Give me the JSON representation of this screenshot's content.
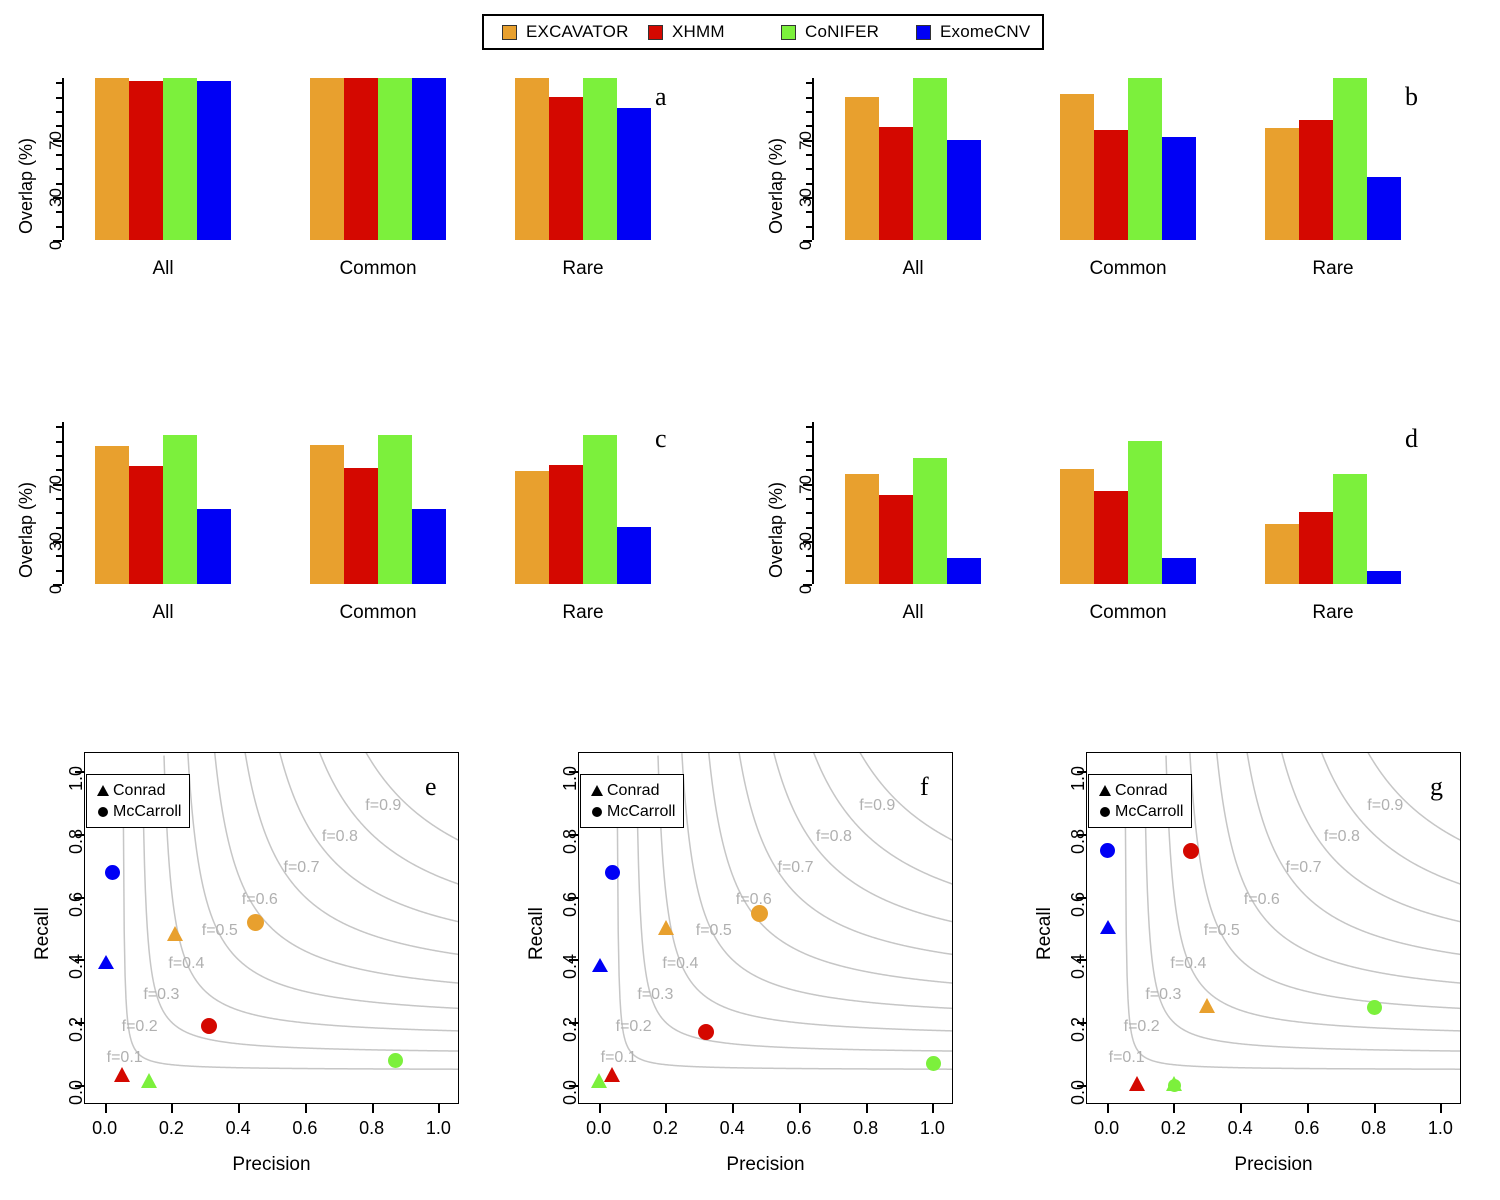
{
  "legend": {
    "items": [
      {
        "label": "EXCAVATOR",
        "color": "#e8a02e",
        "x": 18
      },
      {
        "label": "XHMM",
        "color": "#d40800",
        "x": 164
      },
      {
        "label": "CoNIFER",
        "color": "#7cf03c",
        "x": 297
      },
      {
        "label": "ExomeCNV",
        "color": "#0000f5",
        "x": 432
      }
    ]
  },
  "colors": {
    "excavator": "#e8a02e",
    "xhmm": "#d40800",
    "conifer": "#7cf03c",
    "exomecnv": "#0000f5",
    "contour": "#c6c6c6",
    "flabel": "#b0b0b0"
  },
  "bar_axis": {
    "ylabel": "Overlap (%)",
    "ticks": [
      0,
      30,
      70
    ],
    "tick_labels": [
      "0",
      "30",
      "70"
    ],
    "group_labels": [
      "All",
      "Common",
      "Rare"
    ],
    "series_order": [
      "EXCAVATOR",
      "XHMM",
      "CoNIFER",
      "ExomeCNV"
    ],
    "ymax": 113
  },
  "chart_data": [
    {
      "type": "bar",
      "panel": "a",
      "title": "a",
      "ylabel": "Overlap (%)",
      "xlabel": "",
      "ylim": [
        0,
        113
      ],
      "yticks": [
        0,
        30,
        70
      ],
      "categories": [
        "All",
        "Common",
        "Rare"
      ],
      "series": [
        {
          "name": "EXCAVATOR",
          "color": "#e8a02e",
          "values": [
            113,
            113,
            113
          ]
        },
        {
          "name": "XHMM",
          "color": "#d40800",
          "values": [
            111,
            113,
            100
          ]
        },
        {
          "name": "CoNIFER",
          "color": "#7cf03c",
          "values": [
            113,
            113,
            113
          ]
        },
        {
          "name": "ExomeCNV",
          "color": "#0000f5",
          "values": [
            111,
            113,
            92
          ]
        }
      ]
    },
    {
      "type": "bar",
      "panel": "b",
      "title": "b",
      "ylabel": "Overlap (%)",
      "xlabel": "",
      "ylim": [
        0,
        113
      ],
      "yticks": [
        0,
        30,
        70
      ],
      "categories": [
        "All",
        "Common",
        "Rare"
      ],
      "series": [
        {
          "name": "EXCAVATOR",
          "color": "#e8a02e",
          "values": [
            100,
            102,
            78
          ]
        },
        {
          "name": "XHMM",
          "color": "#d40800",
          "values": [
            79,
            77,
            84
          ]
        },
        {
          "name": "CoNIFER",
          "color": "#7cf03c",
          "values": [
            113,
            113,
            113
          ]
        },
        {
          "name": "ExomeCNV",
          "color": "#0000f5",
          "values": [
            70,
            72,
            44
          ]
        }
      ]
    },
    {
      "type": "bar",
      "panel": "c",
      "title": "c",
      "ylabel": "Overlap (%)",
      "xlabel": "",
      "ylim": [
        0,
        113
      ],
      "yticks": [
        0,
        30,
        70
      ],
      "categories": [
        "All",
        "Common",
        "Rare"
      ],
      "series": [
        {
          "name": "EXCAVATOR",
          "color": "#e8a02e",
          "values": [
            96,
            97,
            79
          ]
        },
        {
          "name": "XHMM",
          "color": "#d40800",
          "values": [
            82,
            81,
            83
          ]
        },
        {
          "name": "CoNIFER",
          "color": "#7cf03c",
          "values": [
            104,
            104,
            104
          ]
        },
        {
          "name": "ExomeCNV",
          "color": "#0000f5",
          "values": [
            52,
            52,
            40
          ]
        }
      ]
    },
    {
      "type": "bar",
      "panel": "d",
      "title": "d",
      "ylabel": "Overlap (%)",
      "xlabel": "",
      "ylim": [
        0,
        113
      ],
      "yticks": [
        0,
        30,
        70
      ],
      "categories": [
        "All",
        "Common",
        "Rare"
      ],
      "series": [
        {
          "name": "EXCAVATOR",
          "color": "#e8a02e",
          "values": [
            77,
            80,
            42
          ]
        },
        {
          "name": "XHMM",
          "color": "#d40800",
          "values": [
            62,
            65,
            50
          ]
        },
        {
          "name": "CoNIFER",
          "color": "#7cf03c",
          "values": [
            88,
            100,
            77
          ]
        },
        {
          "name": "ExomeCNV",
          "color": "#0000f5",
          "values": [
            18,
            18,
            9
          ]
        }
      ]
    },
    {
      "type": "scatter",
      "panel": "e",
      "title": "e",
      "xlabel": "Precision",
      "ylabel": "Recall",
      "xlim": [
        0,
        1
      ],
      "ylim": [
        0,
        1
      ],
      "xticks": [
        0.0,
        0.2,
        0.4,
        0.6,
        0.8,
        1.0
      ],
      "yticks": [
        0.0,
        0.2,
        0.4,
        0.6,
        0.8,
        1.0
      ],
      "xtick_labels": [
        "0.0",
        "0.2",
        "0.4",
        "0.6",
        "0.8",
        "1.0"
      ],
      "ytick_labels": [
        "0.0",
        "0.2",
        "0.4",
        "0.6",
        "0.8",
        "1.0"
      ],
      "legend": {
        "title": "",
        "entries": [
          {
            "label": "Conrad",
            "marker": "triangle"
          },
          {
            "label": "McCarroll",
            "marker": "circle"
          }
        ]
      },
      "contour_levels": [
        0.1,
        0.2,
        0.3,
        0.4,
        0.5,
        0.6,
        0.7,
        0.8,
        0.9
      ],
      "contour_labels": [
        "f=0.1",
        "f=0.2",
        "f=0.3",
        "f=0.4",
        "f=0.5",
        "f=0.6",
        "f=0.7",
        "f=0.8",
        "f=0.9"
      ],
      "points": [
        {
          "tool": "ExomeCNV",
          "dataset": "McCarroll",
          "marker": "circle",
          "color": "#0000f5",
          "x": 0.02,
          "y": 0.68,
          "size": 15
        },
        {
          "tool": "ExomeCNV",
          "dataset": "Conrad",
          "marker": "triangle",
          "color": "#0000f5",
          "x": 0.0,
          "y": 0.39,
          "size": 16
        },
        {
          "tool": "EXCAVATOR",
          "dataset": "Conrad",
          "marker": "triangle",
          "color": "#e8a02e",
          "x": 0.21,
          "y": 0.48,
          "size": 17
        },
        {
          "tool": "EXCAVATOR",
          "dataset": "McCarroll",
          "marker": "circle",
          "color": "#e8a02e",
          "x": 0.45,
          "y": 0.52,
          "size": 17
        },
        {
          "tool": "XHMM",
          "dataset": "McCarroll",
          "marker": "circle",
          "color": "#d40800",
          "x": 0.31,
          "y": 0.19,
          "size": 16
        },
        {
          "tool": "XHMM",
          "dataset": "Conrad",
          "marker": "triangle",
          "color": "#d40800",
          "x": 0.05,
          "y": 0.03,
          "size": 17
        },
        {
          "tool": "CoNIFER",
          "dataset": "Conrad",
          "marker": "triangle",
          "color": "#7cf03c",
          "x": 0.13,
          "y": 0.01,
          "size": 17
        },
        {
          "tool": "CoNIFER",
          "dataset": "McCarroll",
          "marker": "circle",
          "color": "#7cf03c",
          "x": 0.87,
          "y": 0.08,
          "size": 15
        }
      ]
    },
    {
      "type": "scatter",
      "panel": "f",
      "title": "f",
      "xlabel": "Precision",
      "ylabel": "Recall",
      "xlim": [
        0,
        1
      ],
      "ylim": [
        0,
        1
      ],
      "xticks": [
        0.0,
        0.2,
        0.4,
        0.6,
        0.8,
        1.0
      ],
      "yticks": [
        0.0,
        0.2,
        0.4,
        0.6,
        0.8,
        1.0
      ],
      "xtick_labels": [
        "0.0",
        "0.2",
        "0.4",
        "0.6",
        "0.8",
        "1.0"
      ],
      "ytick_labels": [
        "0.0",
        "0.2",
        "0.4",
        "0.6",
        "0.8",
        "1.0"
      ],
      "legend": {
        "title": "",
        "entries": [
          {
            "label": "Conrad",
            "marker": "triangle"
          },
          {
            "label": "McCarroll",
            "marker": "circle"
          }
        ]
      },
      "contour_levels": [
        0.1,
        0.2,
        0.3,
        0.4,
        0.5,
        0.6,
        0.7,
        0.8,
        0.9
      ],
      "contour_labels": [
        "f=0.1",
        "f=0.2",
        "f=0.3",
        "f=0.4",
        "f=0.5",
        "f=0.6",
        "f=0.7",
        "f=0.8",
        "f=0.9"
      ],
      "points": [
        {
          "tool": "ExomeCNV",
          "dataset": "McCarroll",
          "marker": "circle",
          "color": "#0000f5",
          "x": 0.04,
          "y": 0.68,
          "size": 15
        },
        {
          "tool": "ExomeCNV",
          "dataset": "Conrad",
          "marker": "triangle",
          "color": "#0000f5",
          "x": 0.0,
          "y": 0.38,
          "size": 16
        },
        {
          "tool": "EXCAVATOR",
          "dataset": "Conrad",
          "marker": "triangle",
          "color": "#e8a02e",
          "x": 0.2,
          "y": 0.5,
          "size": 17
        },
        {
          "tool": "EXCAVATOR",
          "dataset": "McCarroll",
          "marker": "circle",
          "color": "#e8a02e",
          "x": 0.48,
          "y": 0.55,
          "size": 17
        },
        {
          "tool": "XHMM",
          "dataset": "McCarroll",
          "marker": "circle",
          "color": "#d40800",
          "x": 0.32,
          "y": 0.17,
          "size": 16
        },
        {
          "tool": "XHMM",
          "dataset": "Conrad",
          "marker": "triangle",
          "color": "#d40800",
          "x": 0.04,
          "y": 0.03,
          "size": 17
        },
        {
          "tool": "CoNIFER",
          "dataset": "Conrad",
          "marker": "triangle",
          "color": "#7cf03c",
          "x": 0.0,
          "y": 0.01,
          "size": 17
        },
        {
          "tool": "CoNIFER",
          "dataset": "McCarroll",
          "marker": "circle",
          "color": "#7cf03c",
          "x": 1.0,
          "y": 0.07,
          "size": 15
        }
      ]
    },
    {
      "type": "scatter",
      "panel": "g",
      "title": "g",
      "xlabel": "Precision",
      "ylabel": "Recall",
      "xlim": [
        0,
        1
      ],
      "ylim": [
        0,
        1
      ],
      "xticks": [
        0.0,
        0.2,
        0.4,
        0.6,
        0.8,
        1.0
      ],
      "yticks": [
        0.0,
        0.2,
        0.4,
        0.6,
        0.8,
        1.0
      ],
      "xtick_labels": [
        "0.0",
        "0.2",
        "0.4",
        "0.6",
        "0.8",
        "1.0"
      ],
      "ytick_labels": [
        "0.0",
        "0.2",
        "0.4",
        "0.6",
        "0.8",
        "1.0"
      ],
      "legend": {
        "title": "",
        "entries": [
          {
            "label": "Conrad",
            "marker": "triangle"
          },
          {
            "label": "McCarroll",
            "marker": "circle"
          }
        ]
      },
      "contour_levels": [
        0.1,
        0.2,
        0.3,
        0.4,
        0.5,
        0.6,
        0.7,
        0.8,
        0.9
      ],
      "contour_labels": [
        "f=0.1",
        "f=0.2",
        "f=0.3",
        "f=0.4",
        "f=0.5",
        "f=0.6",
        "f=0.7",
        "f=0.8",
        "f=0.9"
      ],
      "points": [
        {
          "tool": "ExomeCNV",
          "dataset": "McCarroll",
          "marker": "circle",
          "color": "#0000f5",
          "x": 0.0,
          "y": 0.75,
          "size": 15
        },
        {
          "tool": "ExomeCNV",
          "dataset": "Conrad",
          "marker": "triangle",
          "color": "#0000f5",
          "x": 0.0,
          "y": 0.5,
          "size": 16
        },
        {
          "tool": "XHMM",
          "dataset": "McCarroll",
          "marker": "circle",
          "color": "#d40800",
          "x": 0.25,
          "y": 0.75,
          "size": 16
        },
        {
          "tool": "EXCAVATOR",
          "dataset": "Conrad",
          "marker": "triangle",
          "color": "#e8a02e",
          "x": 0.3,
          "y": 0.25,
          "size": 17
        },
        {
          "tool": "CoNIFER",
          "dataset": "McCarroll",
          "marker": "circle",
          "color": "#7cf03c",
          "x": 0.8,
          "y": 0.25,
          "size": 15
        },
        {
          "tool": "XHMM",
          "dataset": "Conrad",
          "marker": "triangle",
          "color": "#d40800",
          "x": 0.09,
          "y": 0.0,
          "size": 17
        },
        {
          "tool": "CoNIFER",
          "dataset": "Conrad",
          "marker": "triangle",
          "color": "#7cf03c",
          "x": 0.2,
          "y": 0.0,
          "size": 17
        },
        {
          "tool": "CoNIFER",
          "dataset": "McCarroll",
          "marker": "circle",
          "color": "#7cf03c",
          "x": 0.2,
          "y": 0.0,
          "size": 13
        }
      ]
    }
  ],
  "panel_letters": [
    "a",
    "b",
    "c",
    "d",
    "e",
    "f",
    "g"
  ]
}
